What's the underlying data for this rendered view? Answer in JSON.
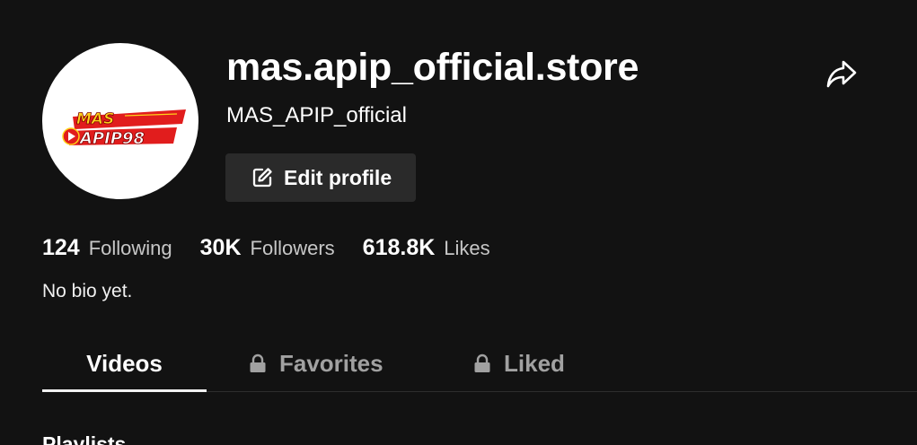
{
  "profile": {
    "username": "mas.apip_official.store",
    "nickname": "MAS_APIP_official",
    "avatar_logo_text": "MAS APIP98",
    "edit_button_label": "Edit profile",
    "bio": "No bio yet."
  },
  "stats": {
    "following_count": "124",
    "following_label": "Following",
    "followers_count": "30K",
    "followers_label": "Followers",
    "likes_count": "618.8K",
    "likes_label": "Likes"
  },
  "tabs": {
    "videos": "Videos",
    "favorites": "Favorites",
    "liked": "Liked"
  },
  "section": {
    "playlists_title": "Playlists"
  },
  "icons": {
    "share": "share-icon",
    "edit": "edit-icon",
    "lock": "lock-icon"
  },
  "colors": {
    "background": "#121212",
    "button_bg": "#2a2a2a",
    "muted_text": "#a1a1a1",
    "logo_red": "#e11d1d",
    "logo_yellow": "#ffd21a"
  }
}
